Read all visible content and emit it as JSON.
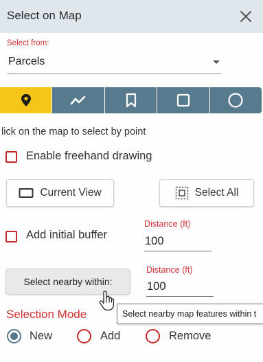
{
  "header": {
    "title": "Select on Map"
  },
  "select_from": {
    "label": "Select from:",
    "value": "Parcels"
  },
  "toolbar": {
    "tools": [
      {
        "icon": "map-pin-icon",
        "active": true
      },
      {
        "icon": "polyline-icon",
        "active": false
      },
      {
        "icon": "bookmark-icon",
        "active": false
      },
      {
        "icon": "rectangle-icon",
        "active": false
      },
      {
        "icon": "circle-icon",
        "active": false
      }
    ],
    "active_color": "#f5c518",
    "color": "#587a8e"
  },
  "hint": "lick on the map to select by point",
  "freehand": {
    "label": "Enable freehand drawing",
    "checked": false
  },
  "buttons": {
    "current_view": "Current View",
    "select_all": "Select All"
  },
  "buffer": {
    "label": "Add initial buffer",
    "checked": false,
    "distance_label": "Distance (ft)",
    "distance_value": "100"
  },
  "nearby": {
    "button_label": "Select nearby within:",
    "distance_label": "Distance (ft)",
    "distance_value": "100"
  },
  "tooltip": "Select nearby map features within t",
  "selection_mode": {
    "label": "Selection Mode",
    "options": [
      {
        "label": "New",
        "checked": true
      },
      {
        "label": "Add",
        "checked": false
      },
      {
        "label": "Remove",
        "checked": false
      }
    ]
  }
}
